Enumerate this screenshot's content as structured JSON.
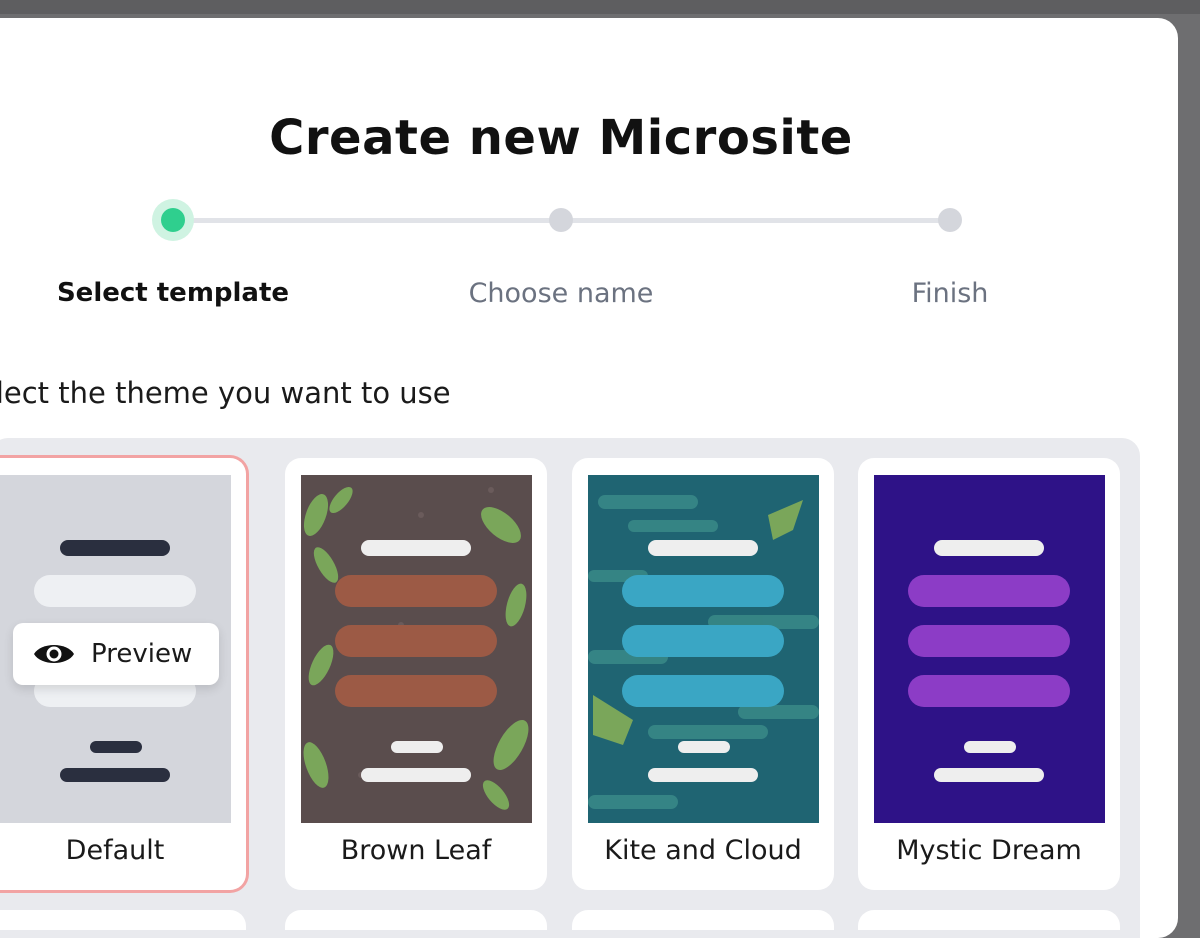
{
  "modal": {
    "title": "Create new Microsite",
    "subtitle": "elect the theme you want to use"
  },
  "stepper": {
    "steps": [
      {
        "label": "Select template",
        "state": "active"
      },
      {
        "label": "Choose name",
        "state": "pending"
      },
      {
        "label": "Finish",
        "state": "pending"
      }
    ],
    "active_color": "#2fcf8e",
    "pending_color": "#d4d6dc"
  },
  "themes": [
    {
      "name": "Default",
      "selected": true,
      "preview_label": "Preview",
      "bg": "#d4d6dc",
      "accent": "#2a2f3f"
    },
    {
      "name": "Brown Leaf",
      "selected": false,
      "bg": "#5a4d4d",
      "accent": "#9c5a45"
    },
    {
      "name": "Kite and Cloud",
      "selected": false,
      "bg": "#1f6472",
      "accent": "#3aa6c4"
    },
    {
      "name": "Mystic Dream",
      "selected": false,
      "bg": "#2e1287",
      "accent": "#8c3cc6"
    }
  ],
  "colors": {
    "selected_border": "#f2a3a3",
    "grid_bg": "#e9eaee"
  }
}
